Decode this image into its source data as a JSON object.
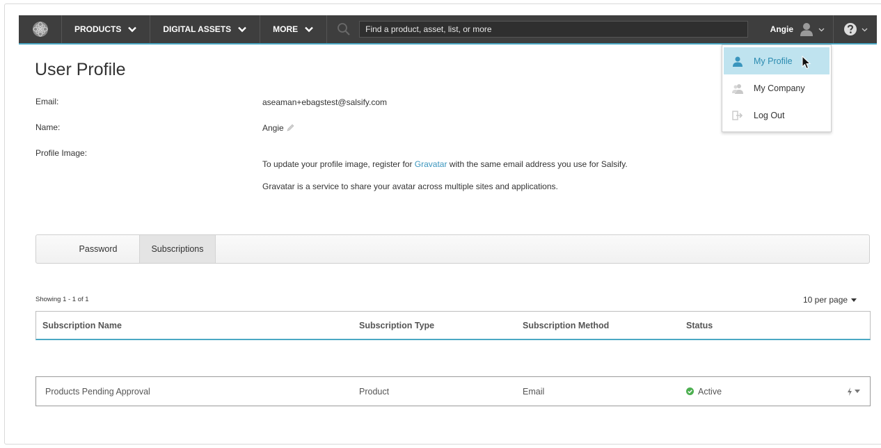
{
  "nav": {
    "products_label": "PRODUCTS",
    "digital_assets_label": "DIGITAL ASSETS",
    "more_label": "MORE",
    "search_placeholder": "Find a product, asset, list, or more",
    "user_label": "Angie"
  },
  "user_dropdown": {
    "items": [
      {
        "label": "My Profile",
        "icon": "user-icon",
        "active": true
      },
      {
        "label": "My Company",
        "icon": "company-icon",
        "active": false
      },
      {
        "label": "Log Out",
        "icon": "logout-icon",
        "active": false
      }
    ]
  },
  "profile": {
    "title": "User Profile",
    "email_label": "Email:",
    "email_value": "aseaman+ebagstest@salsify.com",
    "name_label": "Name:",
    "name_value": "Angie",
    "image_label": "Profile Image:",
    "image_text_before": "To update your profile image, register for ",
    "image_link": "Gravatar",
    "image_text_after": " with the same email address you use for Salsify.",
    "image_note": "Gravatar is a service to share your avatar across multiple sites and applications."
  },
  "tabs": [
    {
      "label": "Password",
      "selected": false
    },
    {
      "label": "Subscriptions",
      "selected": true
    }
  ],
  "subscriptions": {
    "showing": "Showing 1 - 1 of 1",
    "per_page": "10 per page",
    "columns": {
      "name": "Subscription Name",
      "type": "Subscription Type",
      "method": "Subscription Method",
      "status": "Status"
    },
    "rows": [
      {
        "name": "Products Pending Approval",
        "type": "Product",
        "method": "Email",
        "status": "Active"
      }
    ]
  },
  "colors": {
    "nav_bg": "#3e3e3e",
    "accent": "#4aa8c4",
    "link": "#3a95bd",
    "active_status": "#4caf50",
    "dropdown_active_bg": "#bfe3ef"
  }
}
